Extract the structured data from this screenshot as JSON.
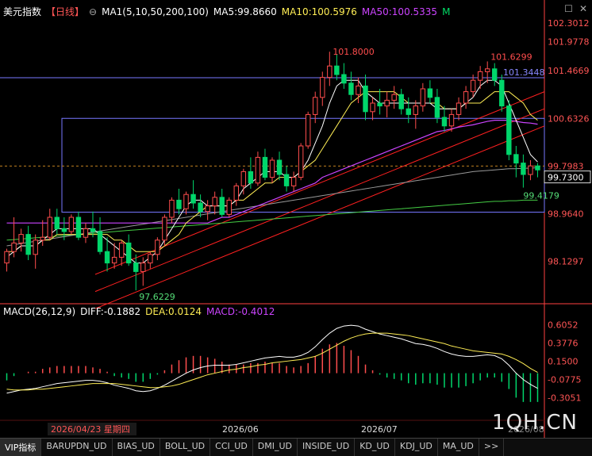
{
  "header": {
    "title": "美元指数",
    "period": "【日线】",
    "ma_label": "MA1(5,10,50,200,100)",
    "ma5": "MA5:99.8660",
    "ma10": "MA10:100.5976",
    "ma50": "MA50:100.5335",
    "m_btn": "M"
  },
  "macd_header": {
    "label": "MACD(26,12,9)",
    "diff": "DIFF:-0.1882",
    "dea": "DEA:0.0124",
    "macd": "MACD:-0.4012"
  },
  "tabs": [
    "VIP指标",
    "BARUPDN_UD",
    "BIAS_UD",
    "BOLL_UD",
    "CCI_UD",
    "DMI_UD",
    "INSIDE_UD",
    "KD_UD",
    "KDJ_UD",
    "MA_UD",
    ">>"
  ],
  "watermark": "1QH.CN",
  "colors": {
    "up": "#ff4d4d",
    "down": "#00d66b",
    "ma5": "#ffffff",
    "ma10": "#ffee55",
    "ma50": "#cc44ff",
    "ma200": "#44cc44",
    "ma100": "#999999",
    "axis": "#ff4040",
    "box": "#7777ff"
  },
  "chart_data": [
    {
      "type": "candlestick",
      "name": "美元指数 日线",
      "ylim": [
        97.4,
        102.4
      ],
      "y_ticks": [
        "102.3012",
        "101.9778",
        "101.4669",
        "100.6326",
        "99.7983",
        "98.9640",
        "98.1297"
      ],
      "x_labels": [
        "2026/04/23 星期四",
        "2026/06",
        "2026/07",
        "2026/08"
      ],
      "current_price": "99.7300",
      "annotations": [
        {
          "text": "101.8000",
          "type": "high"
        },
        {
          "text": "101.6299",
          "type": "high"
        },
        {
          "text": "101.3448",
          "type": "level"
        },
        {
          "text": "99.4179",
          "type": "low"
        },
        {
          "text": "97.6229",
          "type": "low"
        }
      ],
      "candles": [
        [
          98.1,
          98.35,
          97.95,
          98.3
        ],
        [
          98.3,
          98.9,
          98.2,
          98.45
        ],
        [
          98.45,
          98.7,
          98.3,
          98.6
        ],
        [
          98.6,
          98.75,
          98.15,
          98.25
        ],
        [
          98.25,
          98.6,
          98.0,
          98.5
        ],
        [
          98.5,
          98.85,
          98.4,
          98.55
        ],
        [
          98.55,
          99.05,
          98.5,
          98.9
        ],
        [
          98.9,
          99.05,
          98.6,
          98.7
        ],
        [
          98.7,
          98.9,
          98.5,
          98.65
        ],
        [
          98.65,
          98.95,
          98.6,
          98.9
        ],
        [
          98.9,
          99.0,
          98.5,
          98.55
        ],
        [
          98.55,
          98.8,
          98.45,
          98.7
        ],
        [
          98.7,
          99.0,
          98.55,
          98.65
        ],
        [
          98.65,
          98.9,
          98.25,
          98.3
        ],
        [
          98.3,
          98.55,
          97.95,
          98.1
        ],
        [
          98.1,
          98.45,
          98.0,
          98.2
        ],
        [
          98.2,
          98.5,
          98.05,
          98.45
        ],
        [
          98.45,
          98.6,
          98.05,
          98.1
        ],
        [
          98.1,
          98.25,
          97.62,
          97.95
        ],
        [
          97.95,
          98.2,
          97.7,
          98.1
        ],
        [
          98.1,
          98.3,
          98.0,
          98.25
        ],
        [
          98.25,
          98.55,
          98.15,
          98.5
        ],
        [
          98.5,
          98.95,
          98.4,
          98.9
        ],
        [
          98.9,
          99.25,
          98.8,
          99.2
        ],
        [
          99.2,
          99.4,
          98.95,
          99.05
        ],
        [
          99.05,
          99.35,
          98.95,
          99.3
        ],
        [
          99.3,
          99.55,
          99.05,
          99.15
        ],
        [
          99.15,
          99.3,
          98.9,
          99.0
        ],
        [
          99.0,
          99.2,
          98.85,
          99.1
        ],
        [
          99.1,
          99.35,
          98.95,
          99.25
        ],
        [
          99.25,
          99.4,
          98.9,
          98.95
        ],
        [
          98.95,
          99.25,
          98.9,
          99.2
        ],
        [
          99.2,
          99.5,
          99.1,
          99.45
        ],
        [
          99.45,
          99.75,
          99.3,
          99.7
        ],
        [
          99.7,
          99.95,
          99.4,
          99.5
        ],
        [
          99.5,
          100.05,
          99.45,
          99.95
        ],
        [
          99.95,
          100.1,
          99.55,
          99.6
        ],
        [
          99.6,
          99.95,
          99.5,
          99.9
        ],
        [
          99.9,
          100.05,
          99.55,
          99.65
        ],
        [
          99.65,
          99.8,
          99.35,
          99.45
        ],
        [
          99.45,
          99.7,
          99.35,
          99.6
        ],
        [
          99.6,
          100.2,
          99.55,
          100.15
        ],
        [
          100.15,
          100.75,
          100.1,
          100.7
        ],
        [
          100.7,
          101.1,
          100.55,
          101.0
        ],
        [
          101.0,
          101.45,
          100.85,
          101.35
        ],
        [
          101.35,
          101.8,
          101.2,
          101.55
        ],
        [
          101.55,
          101.75,
          101.3,
          101.4
        ],
        [
          101.4,
          101.6,
          101.15,
          101.25
        ],
        [
          101.25,
          101.45,
          100.95,
          101.05
        ],
        [
          101.05,
          101.35,
          100.9,
          101.2
        ],
        [
          101.2,
          101.4,
          100.6,
          100.75
        ],
        [
          100.75,
          101.0,
          100.6,
          100.9
        ],
        [
          100.9,
          101.15,
          100.7,
          100.85
        ],
        [
          100.85,
          101.1,
          100.65,
          100.95
        ],
        [
          100.95,
          101.2,
          100.8,
          101.05
        ],
        [
          101.05,
          101.15,
          100.7,
          100.8
        ],
        [
          100.8,
          101.0,
          100.55,
          100.7
        ],
        [
          100.7,
          100.95,
          100.45,
          100.85
        ],
        [
          100.85,
          101.25,
          100.75,
          101.15
        ],
        [
          101.15,
          101.3,
          100.9,
          101.0
        ],
        [
          101.0,
          101.15,
          100.55,
          100.65
        ],
        [
          100.65,
          100.85,
          100.4,
          100.5
        ],
        [
          100.5,
          100.8,
          100.4,
          100.7
        ],
        [
          100.7,
          101.0,
          100.6,
          100.9
        ],
        [
          100.9,
          101.2,
          100.8,
          101.1
        ],
        [
          101.1,
          101.4,
          101.0,
          101.3
        ],
        [
          101.3,
          101.55,
          101.15,
          101.45
        ],
        [
          101.45,
          101.63,
          101.25,
          101.5
        ],
        [
          101.5,
          101.6,
          101.2,
          101.3
        ],
        [
          101.3,
          101.4,
          100.75,
          100.85
        ],
        [
          100.85,
          100.95,
          99.9,
          100.0
        ],
        [
          100.0,
          100.15,
          99.6,
          99.85
        ],
        [
          99.85,
          100.0,
          99.42,
          99.65
        ],
        [
          99.65,
          99.9,
          99.55,
          99.8
        ],
        [
          99.8,
          99.85,
          99.6,
          99.73
        ]
      ],
      "ma5": [
        98.2,
        98.3,
        98.4,
        98.4,
        98.4,
        98.5,
        98.6,
        98.7,
        98.7,
        98.7,
        98.7,
        98.7,
        98.7,
        98.6,
        98.5,
        98.4,
        98.3,
        98.2,
        98.1,
        98.1,
        98.2,
        98.3,
        98.5,
        98.7,
        98.9,
        99.1,
        99.2,
        99.2,
        99.1,
        99.1,
        99.1,
        99.1,
        99.2,
        99.4,
        99.5,
        99.6,
        99.7,
        99.7,
        99.7,
        99.6,
        99.6,
        99.7,
        99.9,
        100.2,
        100.5,
        100.9,
        101.2,
        101.3,
        101.3,
        101.3,
        101.1,
        101.0,
        100.9,
        100.9,
        100.9,
        100.9,
        100.9,
        100.9,
        100.9,
        100.9,
        100.8,
        100.8,
        100.8,
        100.8,
        100.9,
        101.0,
        101.2,
        101.3,
        101.3,
        101.2,
        100.9,
        100.6,
        100.3,
        100.0,
        99.87
      ],
      "ma10": [
        98.3,
        98.3,
        98.4,
        98.4,
        98.4,
        98.5,
        98.5,
        98.6,
        98.6,
        98.6,
        98.6,
        98.6,
        98.6,
        98.6,
        98.6,
        98.5,
        98.5,
        98.4,
        98.3,
        98.3,
        98.3,
        98.3,
        98.4,
        98.5,
        98.6,
        98.8,
        98.9,
        99.0,
        99.1,
        99.1,
        99.1,
        99.1,
        99.2,
        99.2,
        99.3,
        99.4,
        99.5,
        99.5,
        99.6,
        99.6,
        99.6,
        99.7,
        99.8,
        99.9,
        100.1,
        100.3,
        100.5,
        100.7,
        100.9,
        101.0,
        101.1,
        101.1,
        101.1,
        101.1,
        101.1,
        101.0,
        100.9,
        100.9,
        100.9,
        100.9,
        100.9,
        100.8,
        100.8,
        100.8,
        100.9,
        100.9,
        100.9,
        101.0,
        101.1,
        101.1,
        101.1,
        101.0,
        100.9,
        100.7,
        100.6
      ],
      "ma50": [
        98.8,
        98.8,
        98.8,
        98.8,
        98.8,
        98.8,
        98.8,
        98.8,
        98.8,
        98.8,
        98.8,
        98.8,
        98.8,
        98.8,
        98.8,
        98.8,
        98.8,
        98.8,
        98.8,
        98.8,
        98.8,
        98.8,
        98.8,
        98.8,
        98.8,
        98.8,
        98.8,
        98.8,
        98.8,
        98.85,
        98.9,
        98.9,
        98.95,
        99.0,
        99.05,
        99.1,
        99.15,
        99.2,
        99.25,
        99.3,
        99.35,
        99.4,
        99.45,
        99.5,
        99.6,
        99.65,
        99.7,
        99.75,
        99.8,
        99.85,
        99.9,
        99.95,
        100.0,
        100.05,
        100.1,
        100.15,
        100.2,
        100.25,
        100.3,
        100.35,
        100.4,
        100.42,
        100.45,
        100.48,
        100.5,
        100.52,
        100.55,
        100.58,
        100.6,
        100.6,
        100.6,
        100.58,
        100.56,
        100.55,
        100.53
      ],
      "ma200": [
        98.5,
        98.51,
        98.52,
        98.53,
        98.54,
        98.55,
        98.56,
        98.57,
        98.58,
        98.59,
        98.6,
        98.61,
        98.62,
        98.63,
        98.64,
        98.65,
        98.66,
        98.67,
        98.68,
        98.69,
        98.7,
        98.71,
        98.72,
        98.73,
        98.74,
        98.75,
        98.76,
        98.77,
        98.78,
        98.79,
        98.8,
        98.81,
        98.82,
        98.83,
        98.84,
        98.85,
        98.86,
        98.87,
        98.88,
        98.89,
        98.9,
        98.91,
        98.92,
        98.93,
        98.94,
        98.95,
        98.96,
        98.97,
        98.98,
        98.99,
        99.0,
        99.01,
        99.02,
        99.03,
        99.04,
        99.05,
        99.06,
        99.07,
        99.08,
        99.09,
        99.1,
        99.11,
        99.12,
        99.13,
        99.14,
        99.15,
        99.16,
        99.17,
        99.18,
        99.18,
        99.19,
        99.19,
        99.2,
        99.2,
        99.2
      ],
      "ma100": [
        98.4,
        98.42,
        98.44,
        98.46,
        98.48,
        98.5,
        98.52,
        98.54,
        98.56,
        98.58,
        98.6,
        98.62,
        98.64,
        98.66,
        98.68,
        98.7,
        98.72,
        98.74,
        98.76,
        98.78,
        98.8,
        98.82,
        98.84,
        98.86,
        98.88,
        98.9,
        98.92,
        98.94,
        98.96,
        98.98,
        99.0,
        99.02,
        99.04,
        99.06,
        99.08,
        99.1,
        99.12,
        99.14,
        99.16,
        99.18,
        99.2,
        99.22,
        99.24,
        99.26,
        99.28,
        99.3,
        99.32,
        99.34,
        99.36,
        99.38,
        99.4,
        99.42,
        99.44,
        99.46,
        99.48,
        99.5,
        99.52,
        99.54,
        99.56,
        99.58,
        99.6,
        99.62,
        99.64,
        99.66,
        99.68,
        99.7,
        99.71,
        99.72,
        99.73,
        99.74,
        99.75,
        99.75,
        99.76,
        99.76,
        99.77
      ],
      "rect_levels": [
        [
          101.3448,
          101.3448
        ],
        [
          100.6326,
          99.0
        ]
      ],
      "trend_channel": [
        [
          97.9,
          100.5
        ],
        [
          97.6,
          100.2
        ],
        [
          97.3,
          99.9
        ]
      ]
    },
    {
      "type": "macd",
      "name": "MACD(26,12,9)",
      "ylim": [
        -0.55,
        0.7
      ],
      "y_ticks": [
        "0.6052",
        "0.3776",
        "0.1500",
        "-0.0775",
        "-0.3051"
      ],
      "diff": [
        -0.25,
        -0.23,
        -0.21,
        -0.2,
        -0.19,
        -0.17,
        -0.15,
        -0.13,
        -0.12,
        -0.11,
        -0.1,
        -0.09,
        -0.09,
        -0.1,
        -0.12,
        -0.15,
        -0.17,
        -0.19,
        -0.22,
        -0.23,
        -0.22,
        -0.19,
        -0.15,
        -0.1,
        -0.05,
        0.0,
        0.04,
        0.07,
        0.09,
        0.1,
        0.1,
        0.1,
        0.11,
        0.13,
        0.15,
        0.17,
        0.19,
        0.2,
        0.21,
        0.2,
        0.2,
        0.22,
        0.26,
        0.33,
        0.42,
        0.5,
        0.56,
        0.59,
        0.6,
        0.59,
        0.55,
        0.52,
        0.49,
        0.47,
        0.45,
        0.43,
        0.4,
        0.37,
        0.36,
        0.34,
        0.31,
        0.27,
        0.24,
        0.22,
        0.21,
        0.21,
        0.22,
        0.23,
        0.22,
        0.18,
        0.1,
        0.0,
        -0.08,
        -0.14,
        -0.19
      ],
      "dea": [
        -0.2,
        -0.21,
        -0.21,
        -0.21,
        -0.2,
        -0.2,
        -0.19,
        -0.18,
        -0.17,
        -0.16,
        -0.15,
        -0.14,
        -0.13,
        -0.13,
        -0.13,
        -0.13,
        -0.14,
        -0.15,
        -0.16,
        -0.17,
        -0.18,
        -0.18,
        -0.17,
        -0.16,
        -0.14,
        -0.11,
        -0.08,
        -0.05,
        -0.02,
        0.0,
        0.02,
        0.04,
        0.05,
        0.07,
        0.08,
        0.1,
        0.11,
        0.13,
        0.14,
        0.15,
        0.16,
        0.17,
        0.19,
        0.21,
        0.25,
        0.3,
        0.35,
        0.4,
        0.44,
        0.47,
        0.49,
        0.5,
        0.5,
        0.5,
        0.49,
        0.48,
        0.47,
        0.45,
        0.43,
        0.41,
        0.39,
        0.37,
        0.34,
        0.32,
        0.3,
        0.28,
        0.27,
        0.26,
        0.25,
        0.24,
        0.21,
        0.17,
        0.12,
        0.06,
        0.01
      ]
    }
  ]
}
